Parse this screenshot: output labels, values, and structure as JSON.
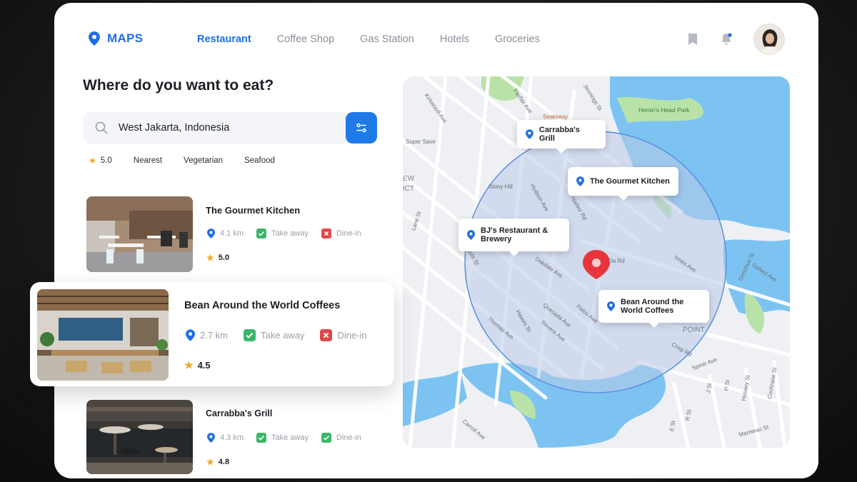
{
  "app": {
    "title": "MAPS"
  },
  "nav": [
    {
      "label": "Restaurant",
      "active": true
    },
    {
      "label": "Coffee Shop",
      "active": false
    },
    {
      "label": "Gas Station",
      "active": false
    },
    {
      "label": "Hotels",
      "active": false
    },
    {
      "label": "Groceries",
      "active": false
    }
  ],
  "header_icons": [
    "bookmark-icon",
    "bell-icon"
  ],
  "page": {
    "heading": "Where do you want to eat?"
  },
  "search": {
    "value": "West Jakarta, Indonesia",
    "filter_icon": "filter-icon"
  },
  "filters": [
    {
      "label": "5.0",
      "icon": "star-icon"
    },
    {
      "label": "Nearest"
    },
    {
      "label": "Vegetarian"
    },
    {
      "label": "Seafood"
    }
  ],
  "restaurants": [
    {
      "name": "The Gourmet Kitchen",
      "distance": "4.1 km",
      "takeaway": "Take away",
      "dinein": "Dine-in",
      "rating": "5.0"
    },
    {
      "name": "Bean Around the World Coffees",
      "distance": "2.7 km",
      "takeaway": "Take away",
      "dinein": "Dine-in",
      "rating": "4.5"
    },
    {
      "name": "Carrabba's Grill",
      "distance": "4.3 km",
      "takeaway": "Take away",
      "dinein": "Dine-in",
      "rating": "4.8"
    }
  ],
  "map": {
    "pins": [
      {
        "label": "Carrabba's Grill"
      },
      {
        "label": "The Gourmet Kitchen"
      },
      {
        "label_line1": "BJ's Restaurant &",
        "label_line2": "Brewery"
      },
      {
        "label_line1": "Bean Around the",
        "label_line2": "World Coffees"
      }
    ],
    "places": [
      "Heron's Head Park",
      "Seakeasy",
      "Super Save",
      "Stony Hill",
      "POINT",
      "EW",
      "ICT"
    ],
    "streets": [
      "Fairfax Ave",
      "Kirkwood Ave",
      "Jennings St",
      "Hudson Ave",
      "Harbor Rd",
      "Ingalls St",
      "Lane St",
      "Oakdale Ave",
      "Innes Ave",
      "Donahue St",
      "Galvez Ave",
      "Hawes St",
      "Thomas Ave",
      "Quesada Ave",
      "Palou Ave",
      "Revere Ave",
      "Crisp Rd",
      "Spear Ave",
      "Carroll Ave",
      "Manseau St",
      "Cochrane St",
      "Hussey St",
      "H St",
      "J St",
      "R St",
      "E St",
      "Da Rd"
    ],
    "colors": {
      "water": "#7cc3f2",
      "park": "#b9e2a8",
      "radius": "#b9cbe8",
      "pin": "#e8353c"
    }
  }
}
